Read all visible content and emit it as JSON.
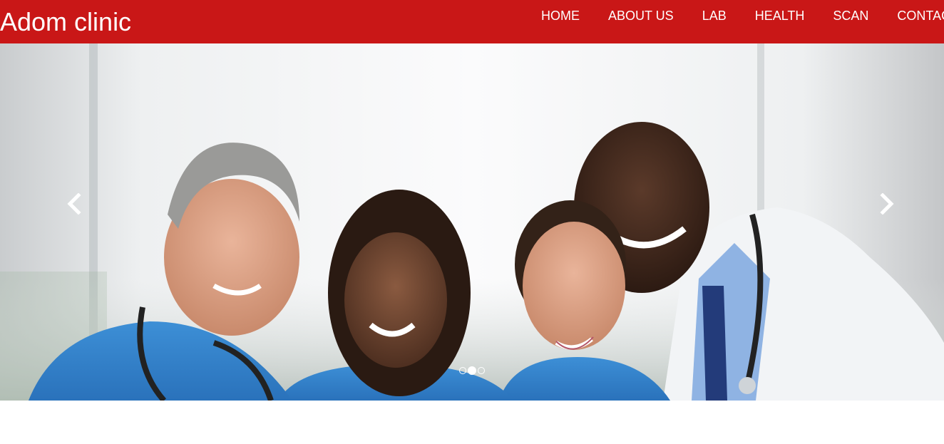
{
  "navbar": {
    "brand": "Adom clinic",
    "background": "#c91717",
    "links": [
      {
        "label": "HOME"
      },
      {
        "label": "ABOUT US"
      },
      {
        "label": "LAB"
      },
      {
        "label": "HEALTH"
      },
      {
        "label": "SCAN"
      },
      {
        "label": "CONTACT"
      }
    ]
  },
  "carousel": {
    "slides": 3,
    "active_index": 1,
    "prev_icon": "chevron-left-icon",
    "next_icon": "chevron-right-icon"
  }
}
